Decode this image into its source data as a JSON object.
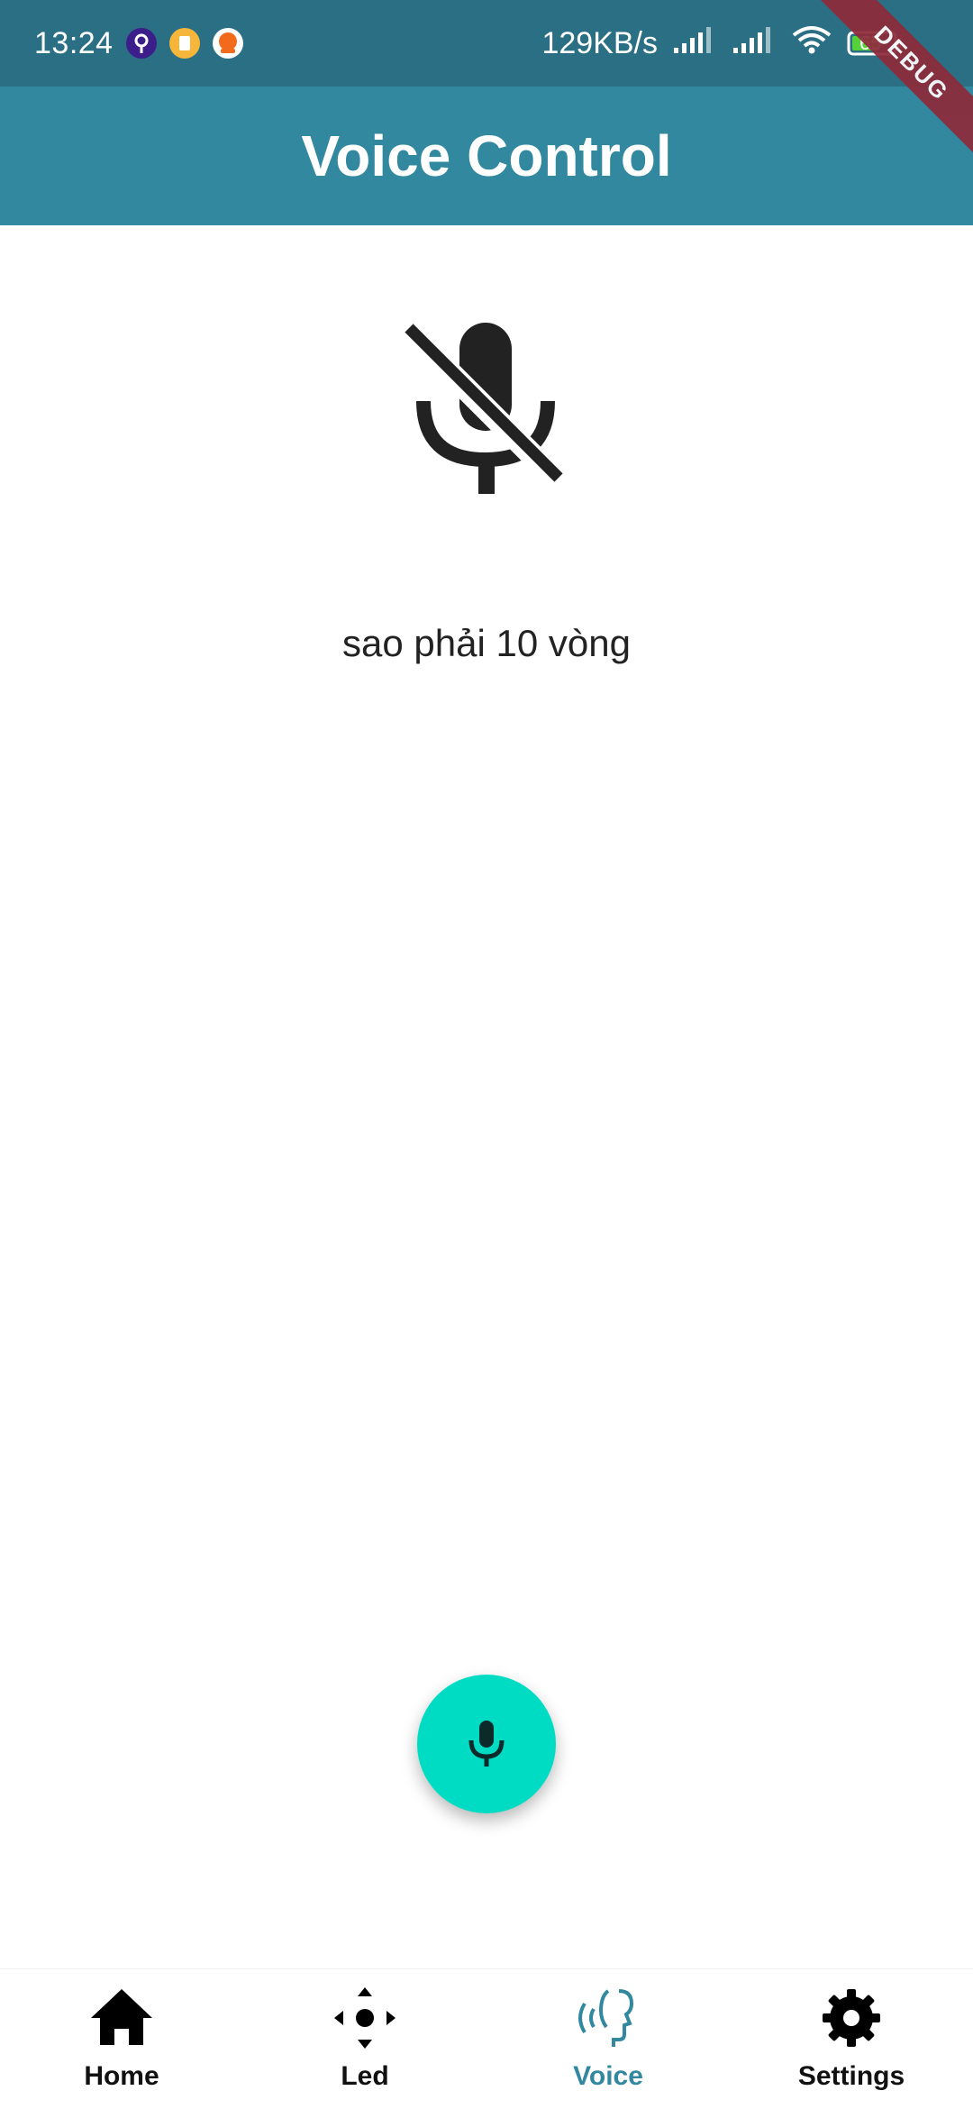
{
  "status_bar": {
    "time": "13:24",
    "network_speed": "129KB/s",
    "battery_level": "65",
    "notification_icons": [
      "vpn-icon",
      "files-icon",
      "orange-app-icon"
    ]
  },
  "debug_banner": "DEBUG",
  "app_bar": {
    "title": "Voice Control",
    "color": "#32889f"
  },
  "main": {
    "status_icon": "mic-off-icon",
    "recognized_text": "sao phải 10 vòng"
  },
  "fab": {
    "icon": "mic-icon",
    "color": "#00dcc4"
  },
  "bottom_nav": {
    "items": [
      {
        "label": "Home",
        "icon": "home-icon",
        "active": false
      },
      {
        "label": "Led",
        "icon": "led-icon",
        "active": false
      },
      {
        "label": "Voice",
        "icon": "voice-icon",
        "active": true
      },
      {
        "label": "Settings",
        "icon": "gear-icon",
        "active": false
      }
    ],
    "active_color": "#32889f"
  }
}
